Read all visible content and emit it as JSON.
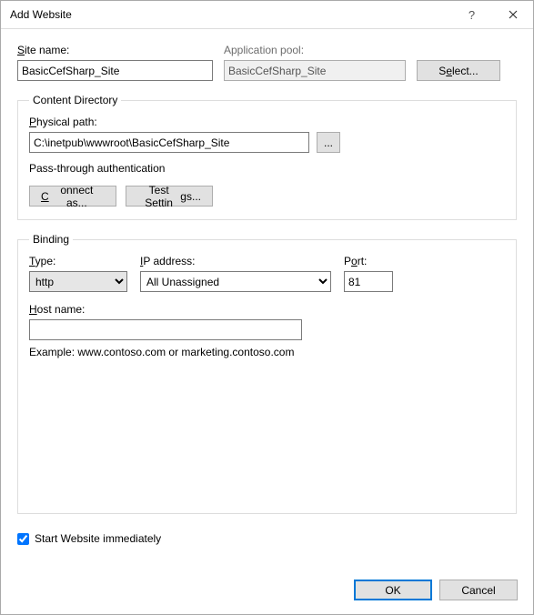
{
  "window": {
    "title": "Add Website"
  },
  "site": {
    "name_label_pre": "",
    "name_u": "S",
    "name_label_post": "ite name:",
    "name_value": "BasicCefSharp_Site",
    "pool_label": "Application pool:",
    "pool_value": "BasicCefSharp_Site",
    "select_pre": "S",
    "select_u": "e",
    "select_post": "lect..."
  },
  "content_dir": {
    "legend": "Content Directory",
    "path_u": "P",
    "path_post": "hysical path:",
    "path_value": "C:\\inetpub\\wwwroot\\BasicCefSharp_Site",
    "browse": "...",
    "passthrough": "Pass-through authentication",
    "connect_u": "C",
    "connect_post": "onnect as...",
    "test_pre": "Test Settin",
    "test_u": "g",
    "test_post": "s..."
  },
  "binding": {
    "legend": "Binding",
    "type_u": "T",
    "type_post": "ype:",
    "type_value": "http",
    "ip_u": "I",
    "ip_post": "P address:",
    "ip_value": "All Unassigned",
    "port_pre": "P",
    "port_u": "o",
    "port_post": "rt:",
    "port_value": "81",
    "host_u": "H",
    "host_post": "ost name:",
    "host_value": "",
    "example": "Example: www.contoso.com or marketing.contoso.com"
  },
  "start": {
    "pre": "Start Website i",
    "u": "m",
    "post": "mediately"
  },
  "footer": {
    "ok": "OK",
    "cancel": "Cancel"
  }
}
